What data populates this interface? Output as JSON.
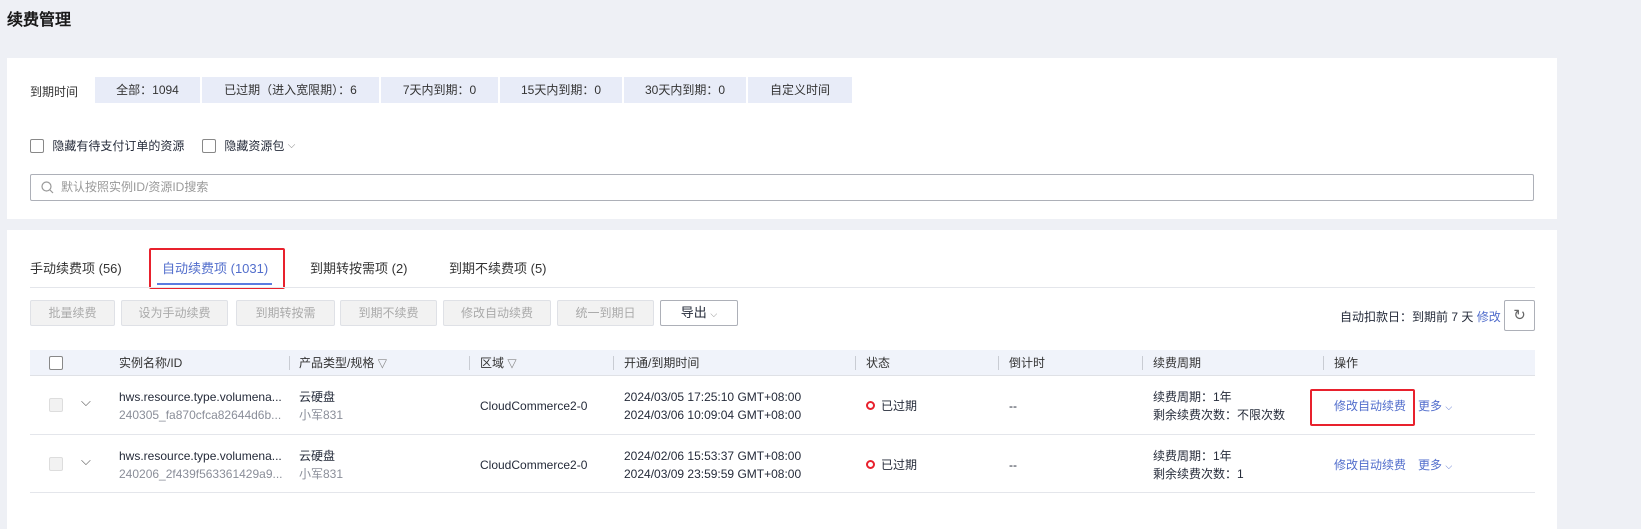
{
  "page_title": "续费管理",
  "filter": {
    "label": "到期时间",
    "tabs": [
      "全部：1094",
      "已过期（进入宽限期）：6",
      "7天内到期：0",
      "15天内到期：0",
      "30天内到期：0",
      "自定义时间"
    ],
    "checkboxes": [
      "隐藏有待支付订单的资源",
      "隐藏资源包"
    ],
    "search_placeholder": "默认按照实例ID/资源ID搜索"
  },
  "tabs": [
    "手动续费项 (56)",
    "自动续费项 (1031)",
    "到期转按需项 (2)",
    "到期不续费项 (5)"
  ],
  "toolbar": {
    "buttons": [
      "批量续费",
      "设为手动续费",
      "到期转按需",
      "到期不续费",
      "修改自动续费",
      "统一到期日"
    ],
    "export": "导出",
    "deduct_text": "自动扣款日：到期前 7 天",
    "modify": "修改"
  },
  "table": {
    "headers": [
      "实例名称/ID",
      "产品类型/规格",
      "区域",
      "开通/到期时间",
      "状态",
      "倒计时",
      "续费周期",
      "操作"
    ],
    "rows": [
      {
        "name": "hws.resource.type.volumena...",
        "id": "240305_fa870cfca82644d6b...",
        "product": "云硬盘",
        "spec": "小军831",
        "region": "CloudCommerce2-0",
        "start": "2024/03/05 17:25:10 GMT+08:00",
        "end": "2024/03/06 10:09:04 GMT+08:00",
        "status": "已过期",
        "countdown": "--",
        "cycle": "续费周期：1年",
        "remaining": "剩余续费次数：不限次数",
        "action": "修改自动续费",
        "more": "更多"
      },
      {
        "name": "hws.resource.type.volumena...",
        "id": "240206_2f439f563361429a9...",
        "product": "云硬盘",
        "spec": "小军831",
        "region": "CloudCommerce2-0",
        "start": "2024/02/06 15:53:37 GMT+08:00",
        "end": "2024/03/09 23:59:59 GMT+08:00",
        "status": "已过期",
        "countdown": "--",
        "cycle": "续费周期：1年",
        "remaining": "剩余续费次数：1",
        "action": "修改自动续费",
        "more": "更多"
      }
    ]
  },
  "colors": {
    "accent": "#526ecc",
    "highlight": "#e8212d",
    "status_expired": "#e8212d"
  }
}
